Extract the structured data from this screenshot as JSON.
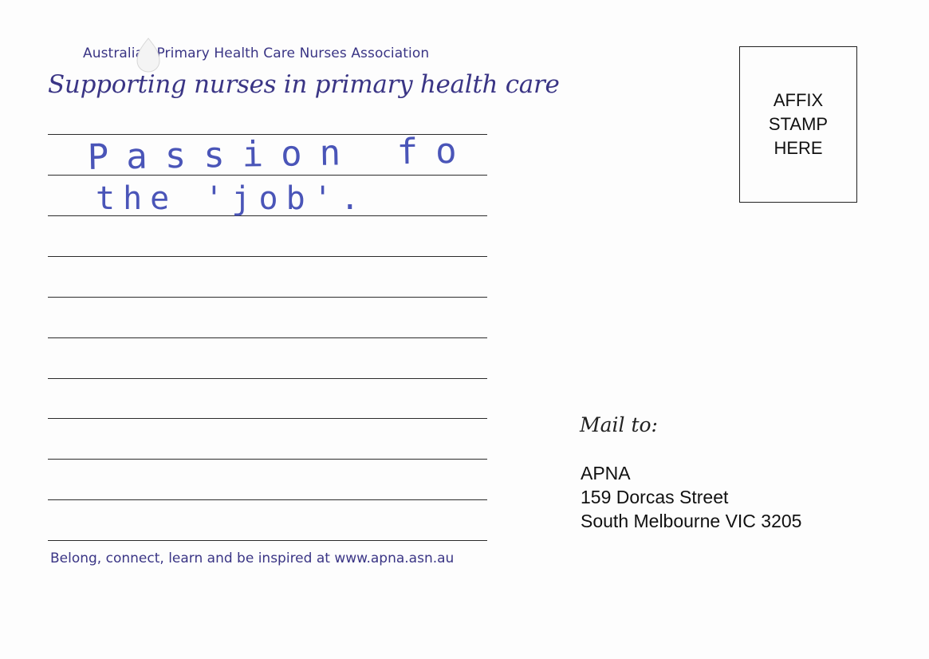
{
  "header": {
    "organization": "Australian Primary Health Care Nurses Association",
    "tagline": "Supporting nurses in primary health care"
  },
  "message": {
    "handwritten_line_1": "Passion for",
    "handwritten_line_2": "the 'job'.",
    "ink_color": "#4a55b8"
  },
  "footer": {
    "text": "Belong, connect, learn and be inspired at www.apna.asn.au"
  },
  "stamp": {
    "line_1": "AFFIX",
    "line_2": "STAMP",
    "line_3": "HERE"
  },
  "mailing": {
    "label": "Mail to:",
    "address_line_1": "APNA",
    "address_line_2": "159 Dorcas Street",
    "address_line_3": "South Melbourne VIC 3205"
  },
  "colors": {
    "brand": "#3a3585",
    "text": "#111111"
  }
}
